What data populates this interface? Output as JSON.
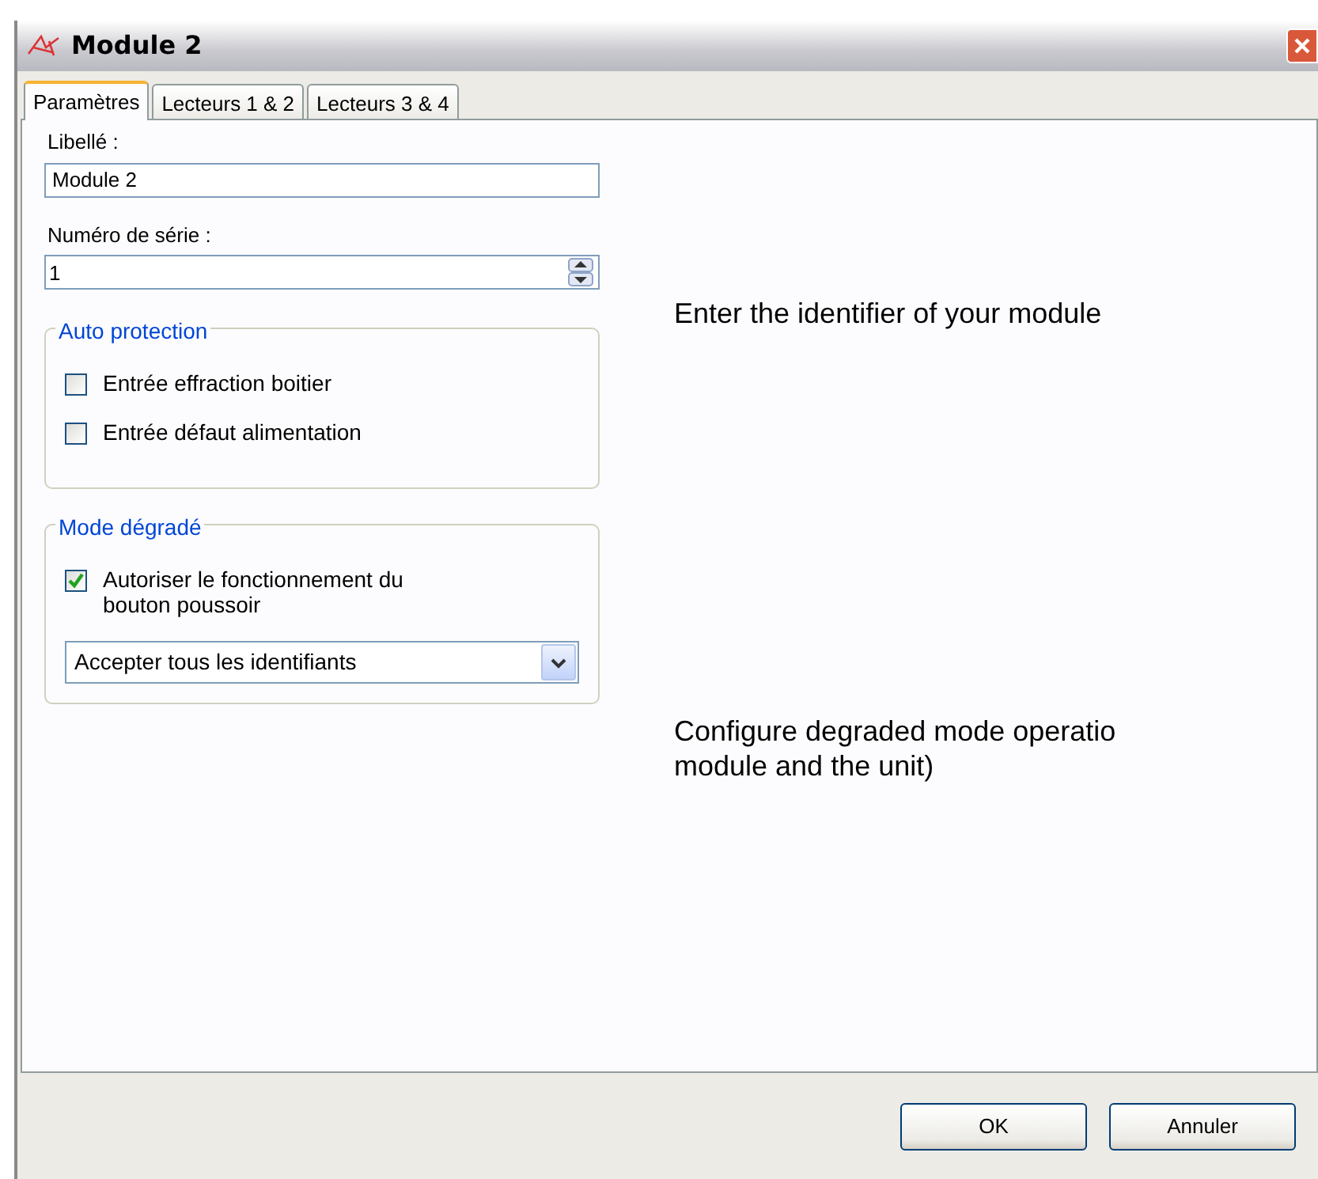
{
  "window": {
    "title": "Module 2"
  },
  "tabs": [
    {
      "label": "Paramètres",
      "selected": true
    },
    {
      "label": "Lecteurs 1 & 2",
      "selected": false
    },
    {
      "label": "Lecteurs 3 & 4",
      "selected": false
    }
  ],
  "label_field": {
    "label": "Libellé :",
    "value": "Module 2"
  },
  "serial_field": {
    "label": "Numéro de série :",
    "value": "1"
  },
  "groups": [
    {
      "title": "Auto protection",
      "items": [
        {
          "kind": "checkbox",
          "label": "Entrée effraction boitier",
          "checked": false
        },
        {
          "kind": "checkbox",
          "label": "Entrée défaut alimentation",
          "checked": false
        }
      ]
    },
    {
      "title": "Mode dégradé",
      "items": [
        {
          "kind": "checkbox",
          "label": "Autoriser le fonctionnement du bouton poussoir",
          "checked": true
        },
        {
          "kind": "dropdown",
          "value": "Accepter tous les identifiants"
        }
      ]
    }
  ],
  "help_texts": [
    {
      "lines": [
        "Enter the identifier of your module"
      ]
    },
    {
      "lines": [
        "Configure degraded mode operatio",
        "module and the unit)"
      ]
    }
  ],
  "buttons": [
    "OK",
    "Annuler"
  ]
}
